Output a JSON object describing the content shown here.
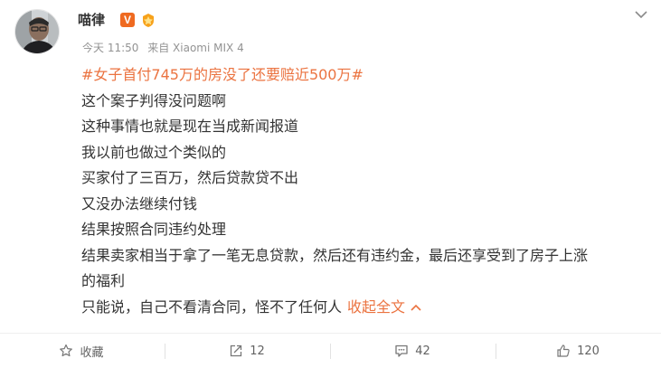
{
  "post": {
    "username": "喵律",
    "v_badge": "V",
    "meta": {
      "time": "今天 11:50",
      "source": "来自 Xiaomi MIX 4"
    },
    "hashtag": "#女子首付745万的房没了还要赔近500万#",
    "lines": [
      "这个案子判得没问题啊",
      "这种事情也就是现在当成新闻报道",
      "我以前也做过个类似的",
      "买家付了三百万，然后贷款贷不出",
      "又没办法继续付钱",
      "结果按照合同违约处理",
      "结果卖家相当于拿了一笔无息贷款，然后还有违约金，最后还享受到了房子上涨",
      "的福利",
      "只能说，自己不看清合同，怪不了任何人"
    ],
    "collapse_label": "收起全文"
  },
  "footer": {
    "favorite_label": "收藏",
    "repost_count": "12",
    "comment_count": "42",
    "like_count": "120"
  },
  "colors": {
    "accent": "#eb7340",
    "text": "#333333",
    "meta": "#939393",
    "v_badge": "#ef6a20"
  }
}
